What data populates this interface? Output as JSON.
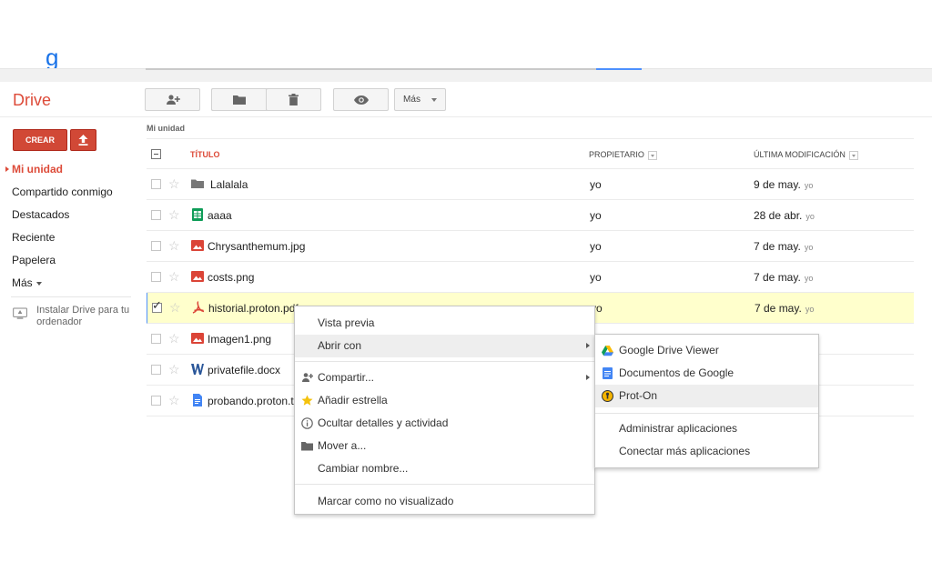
{
  "app": {
    "title": "Drive",
    "logo_fragment": "g"
  },
  "toolbar": {
    "share_icon": "add-person-icon",
    "folder_icon": "folder-icon",
    "trash_icon": "trash-icon",
    "preview_icon": "eye-icon",
    "more_label": "Más"
  },
  "sidebar": {
    "create_label": "CREAR",
    "upload_icon": "upload-icon",
    "items": [
      {
        "label": "Mi unidad",
        "active": true
      },
      {
        "label": "Compartido conmigo"
      },
      {
        "label": "Destacados"
      },
      {
        "label": "Reciente"
      },
      {
        "label": "Papelera"
      },
      {
        "label": "Más"
      }
    ],
    "install_text": "Instalar Drive para tu ordenador"
  },
  "list": {
    "breadcrumb": "Mi unidad",
    "columns": {
      "title": "TÍTULO",
      "owner": "PROPIETARIO",
      "modified": "ÚLTIMA MODIFICACIÓN"
    },
    "rows": [
      {
        "name": "Lalalala",
        "type": "folder",
        "owner": "yo",
        "date": "9 de may.",
        "by": "yo"
      },
      {
        "name": "aaaa",
        "type": "spreadsheet",
        "owner": "yo",
        "date": "28 de abr.",
        "by": "yo"
      },
      {
        "name": "Chrysanthemum.jpg",
        "type": "image",
        "owner": "yo",
        "date": "7 de may.",
        "by": "yo"
      },
      {
        "name": "costs.png",
        "type": "image",
        "owner": "yo",
        "date": "7 de may.",
        "by": "yo"
      },
      {
        "name": "historial.proton.pdf",
        "type": "pdf",
        "owner": "yo",
        "date": "7 de may.",
        "by": "yo",
        "selected": true
      },
      {
        "name": "Imagen1.png",
        "type": "image",
        "owner": "",
        "date": "",
        "by": ""
      },
      {
        "name": "privatefile.docx",
        "type": "word",
        "owner": "",
        "date": "",
        "by": ""
      },
      {
        "name": "probando.proton.txt",
        "type": "doc",
        "owner": "",
        "date": "",
        "by": ""
      }
    ]
  },
  "context_menu": {
    "items": [
      {
        "label": "Vista previa"
      },
      {
        "label": "Abrir con",
        "submenu": true,
        "hover": true
      },
      {
        "label": "Compartir...",
        "icon": "add-person-icon",
        "submenu": true
      },
      {
        "label": "Añadir estrella",
        "icon": "star-icon"
      },
      {
        "label": "Ocultar detalles y actividad",
        "icon": "info-icon"
      },
      {
        "label": "Mover a...",
        "icon": "folder-icon"
      },
      {
        "label": "Cambiar nombre..."
      },
      {
        "label": "Marcar como no visualizado"
      }
    ]
  },
  "open_with_menu": {
    "items": [
      {
        "label": "Google Drive Viewer",
        "icon": "drive-icon"
      },
      {
        "label": "Documentos de Google",
        "icon": "docs-icon"
      },
      {
        "label": "Prot-On",
        "icon": "proton-icon",
        "hover": true
      },
      {
        "label": "Administrar aplicaciones"
      },
      {
        "label": "Conectar más aplicaciones"
      }
    ]
  },
  "colors": {
    "accent": "#dd4b39",
    "create_button": "#d14836",
    "selected_row": "#ffffcc",
    "menu_hover": "#eeeeee"
  }
}
